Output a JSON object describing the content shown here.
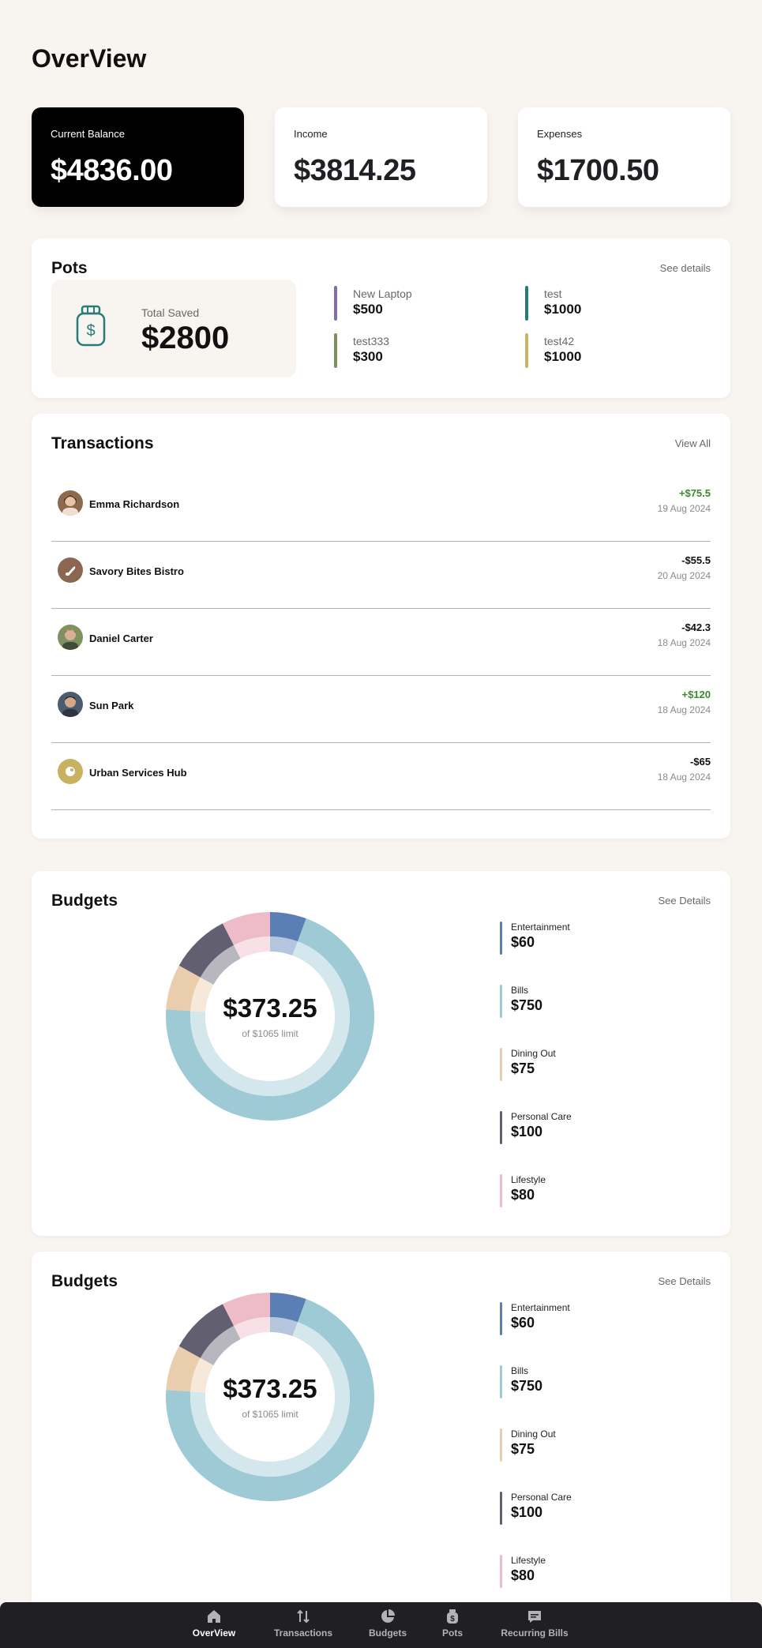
{
  "page": {
    "title": "OverView"
  },
  "summary": [
    {
      "label": "Current Balance",
      "value": "$4836.00"
    },
    {
      "label": "Income",
      "value": "$3814.25"
    },
    {
      "label": "Expenses",
      "value": "$1700.50"
    }
  ],
  "pots": {
    "title": "Pots",
    "link": "See details",
    "total_label": "Total Saved",
    "total_value": "$2800",
    "items": [
      {
        "name": "New Laptop",
        "amount": "$500",
        "color": "#826cb0"
      },
      {
        "name": "test",
        "amount": "$1000",
        "color": "#277c78"
      },
      {
        "name": "test333",
        "amount": "$300",
        "color": "#7f9161"
      },
      {
        "name": "test42",
        "amount": "$1000",
        "color": "#cab361"
      }
    ]
  },
  "transactions": {
    "title": "Transactions",
    "link": "View All",
    "items": [
      {
        "name": "Emma Richardson",
        "amount": "+$75.5",
        "date": "19 Aug 2024",
        "positive": true,
        "avatar": "person-avatar"
      },
      {
        "name": "Savory Bites Bistro",
        "amount": "-$55.5",
        "date": "20 Aug 2024",
        "positive": false,
        "avatar": "restaurant-icon"
      },
      {
        "name": "Daniel Carter",
        "amount": "-$42.3",
        "date": "18 Aug 2024",
        "positive": false,
        "avatar": "person-avatar"
      },
      {
        "name": "Sun Park",
        "amount": "+$120",
        "date": "18 Aug 2024",
        "positive": true,
        "avatar": "person-avatar"
      },
      {
        "name": "Urban Services Hub",
        "amount": "-$65",
        "date": "18 Aug 2024",
        "positive": false,
        "avatar": "service-icon"
      }
    ]
  },
  "budgets": {
    "title": "Budgets",
    "link": "See Details",
    "total": "$373.25",
    "limit_text": "of $1065 limit",
    "items": [
      {
        "name": "Entertainment",
        "amount": "$60",
        "color": "#5b7fb4"
      },
      {
        "name": "Bills",
        "amount": "$750",
        "color": "#9ecad6"
      },
      {
        "name": "Dining Out",
        "amount": "$75",
        "color": "#eacdac"
      },
      {
        "name": "Personal Care",
        "amount": "$100",
        "color": "#626070"
      },
      {
        "name": "Lifestyle",
        "amount": "$80",
        "color": "#eebcc8"
      }
    ]
  },
  "budgets_2": {
    "title": "Budgets",
    "link": "See Details",
    "total": "$373.25",
    "limit_text": "of $1065 limit",
    "items": [
      {
        "name": "Entertainment",
        "amount": "$60",
        "color": "#5b7fb4"
      },
      {
        "name": "Bills",
        "amount": "$750",
        "color": "#9ecad6"
      },
      {
        "name": "Dining Out",
        "amount": "$75",
        "color": "#eacdac"
      },
      {
        "name": "Personal Care",
        "amount": "$100",
        "color": "#626070"
      },
      {
        "name": "Lifestyle",
        "amount": "$80",
        "color": "#eebcc8"
      }
    ]
  },
  "nav": [
    {
      "label": "OverView",
      "icon": "home-icon",
      "active": true
    },
    {
      "label": "Transactions",
      "icon": "arrows-up-down-icon"
    },
    {
      "label": "Budgets",
      "icon": "pie-chart-icon"
    },
    {
      "label": "Pots",
      "icon": "jar-icon"
    },
    {
      "label": "Recurring Bills",
      "icon": "receipt-icon"
    }
  ]
}
